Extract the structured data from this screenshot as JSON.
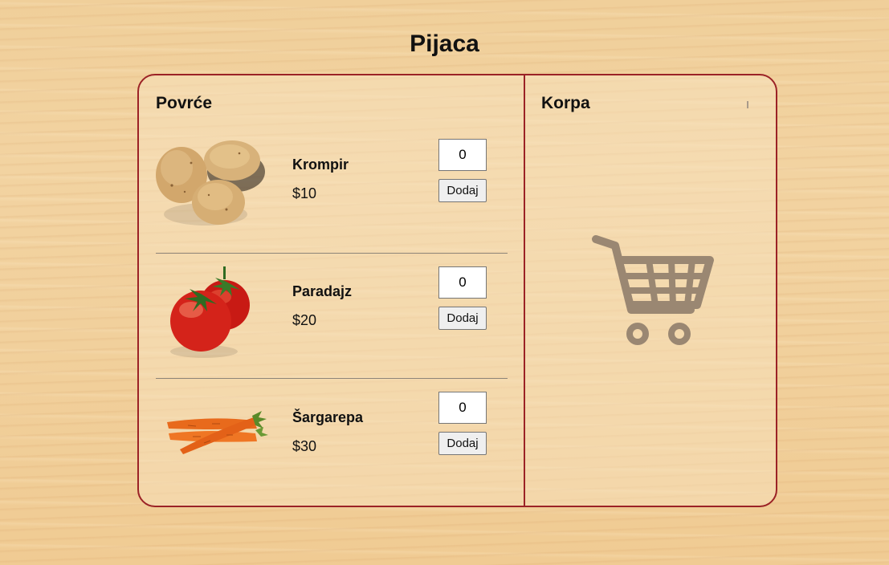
{
  "page": {
    "title": "Pijaca"
  },
  "vegetables": {
    "title": "Povrće",
    "items": [
      {
        "name": "Krompir",
        "price": "$10",
        "quantity": "0",
        "add_label": "Dodaj",
        "image": "potatoes"
      },
      {
        "name": "Paradajz",
        "price": "$20",
        "quantity": "0",
        "add_label": "Dodaj",
        "image": "tomatoes"
      },
      {
        "name": "Šargarepa",
        "price": "$30",
        "quantity": "0",
        "add_label": "Dodaj",
        "image": "carrots"
      }
    ]
  },
  "cart": {
    "title": "Korpa",
    "icon": "shopping-cart-icon"
  },
  "colors": {
    "accent_border": "#9b2226",
    "cart_icon": "#9a8772"
  }
}
